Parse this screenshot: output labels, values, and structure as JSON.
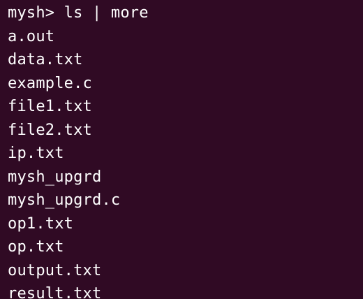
{
  "terminal": {
    "prompt": "mysh> ",
    "command": "ls | more",
    "output": [
      "a.out",
      "data.txt",
      "example.c",
      "file1.txt",
      "file2.txt",
      "ip.txt",
      "mysh_upgrd",
      "mysh_upgrd.c",
      "op1.txt",
      "op.txt",
      "output.txt",
      "result.txt"
    ]
  },
  "colors": {
    "background": "#300a24",
    "text": "#ffffff"
  }
}
